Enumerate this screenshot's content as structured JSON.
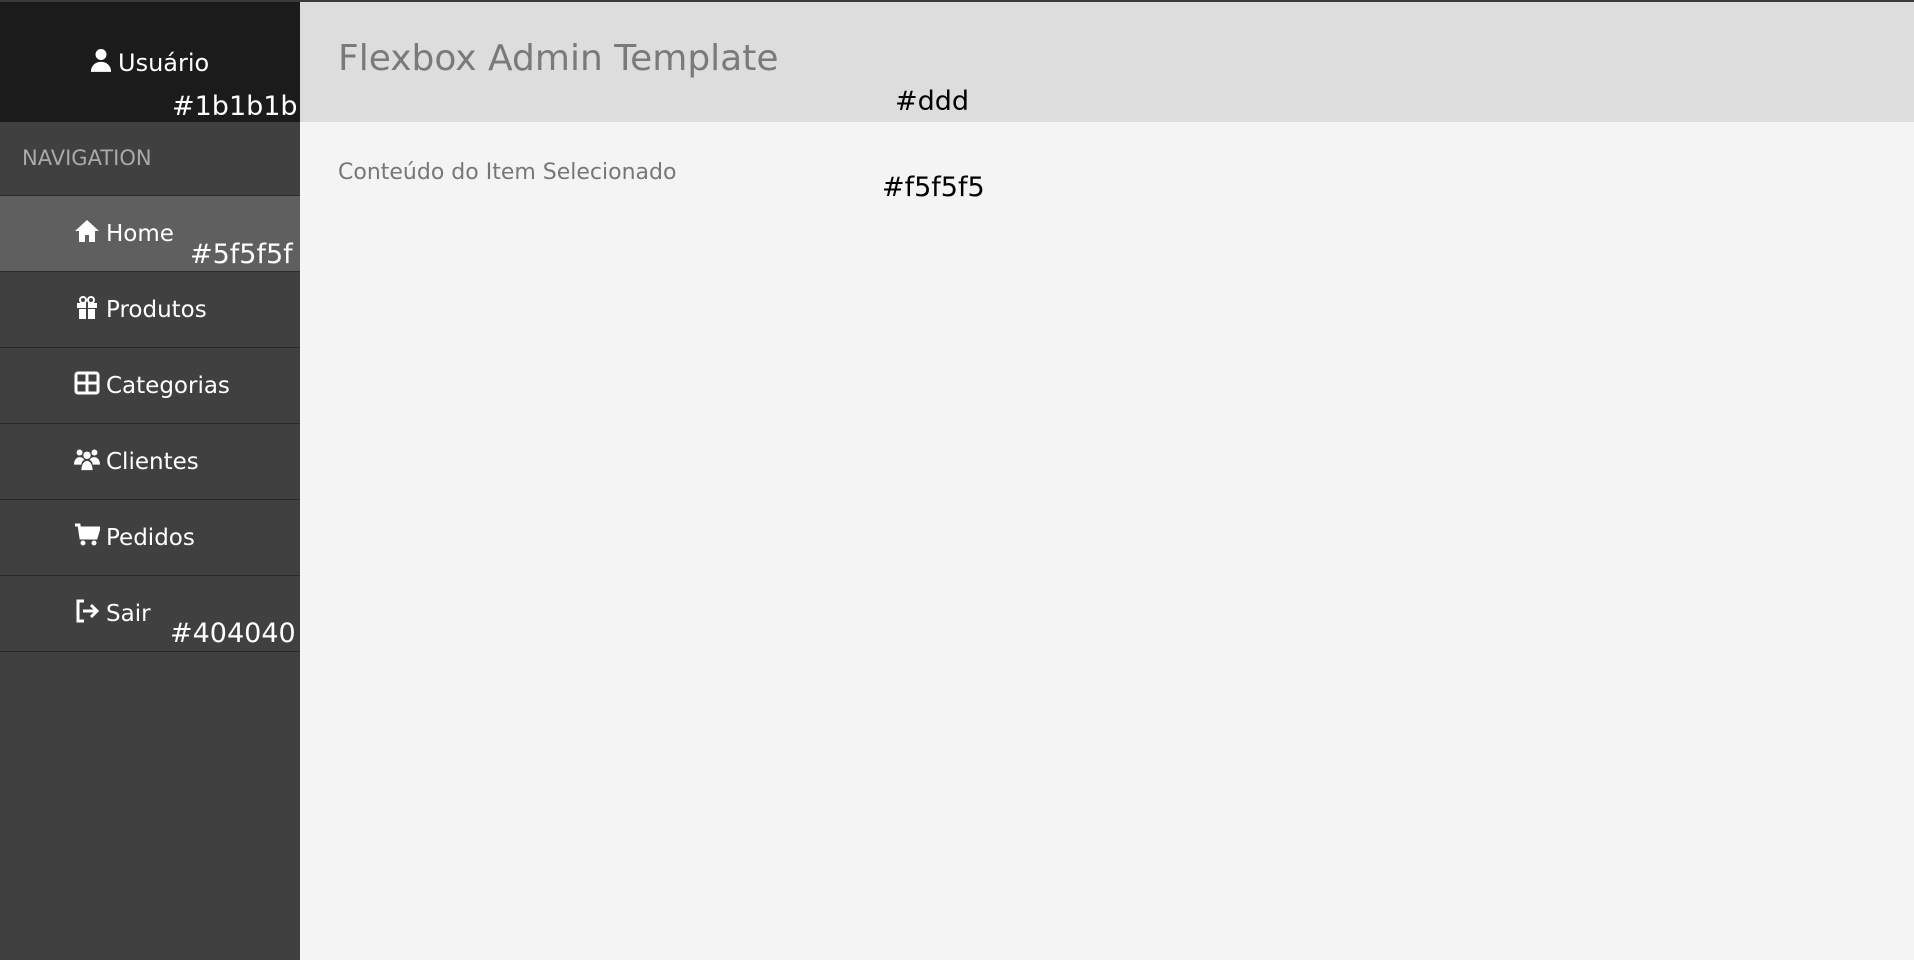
{
  "sidebar": {
    "user_label": "Usuário",
    "header_color": "#1b1b1b",
    "nav_title": "NAVIGATION",
    "items": [
      {
        "label": "Home",
        "icon": "home-icon",
        "active": true
      },
      {
        "label": "Produtos",
        "icon": "gift-icon"
      },
      {
        "label": "Categorias",
        "icon": "table-icon"
      },
      {
        "label": "Clientes",
        "icon": "users-icon"
      },
      {
        "label": "Pedidos",
        "icon": "cart-icon"
      },
      {
        "label": "Sair",
        "icon": "sign-out-icon"
      }
    ],
    "active_color": "#5f5f5f",
    "bg_color": "#404040"
  },
  "header": {
    "title": "Flexbox Admin Template",
    "color": "#ddd"
  },
  "content": {
    "text": "Conteúdo do Item Selecionado",
    "color": "#f5f5f5"
  }
}
